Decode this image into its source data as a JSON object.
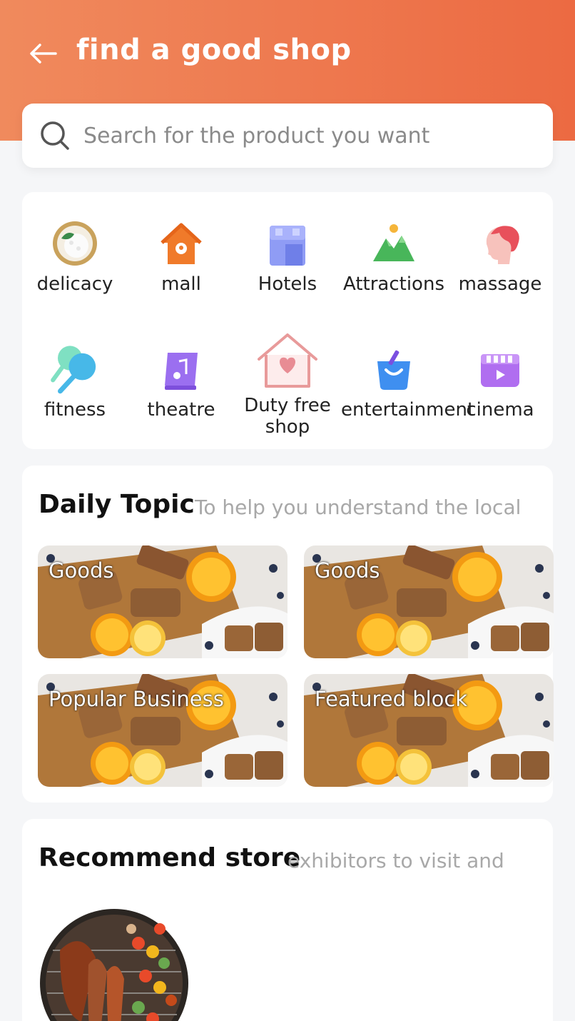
{
  "header": {
    "title": "find a good shop",
    "back_icon": "back-arrow-icon"
  },
  "search": {
    "placeholder": "Search for the product you want",
    "icon": "search-icon"
  },
  "categories": [
    {
      "label": "delicacy",
      "icon": "rice-bowl-icon"
    },
    {
      "label": "mall",
      "icon": "mall-house-icon"
    },
    {
      "label": "Hotels",
      "icon": "hotel-icon"
    },
    {
      "label": "Attractions",
      "icon": "mountain-icon"
    },
    {
      "label": "massage",
      "icon": "massage-icon"
    },
    {
      "label": "fitness",
      "icon": "fitness-icon"
    },
    {
      "label": "theatre",
      "icon": "theatre-icon"
    },
    {
      "label": "Duty free shop",
      "icon": "duty-free-house-icon"
    },
    {
      "label": "entertainment",
      "icon": "shopping-basket-icon"
    },
    {
      "label": "cinema",
      "icon": "cinema-icon"
    }
  ],
  "daily_topic": {
    "title": "Daily Topic",
    "subtitle": "To help you understand the local",
    "tiles": [
      {
        "label": "Goods"
      },
      {
        "label": "Goods"
      },
      {
        "label": "Popular Business"
      },
      {
        "label": "Featured block"
      }
    ]
  },
  "recommend": {
    "title": "Recommend store",
    "subtitle": "exhibitors to visit and"
  },
  "colors": {
    "header_start": "#f08a5d",
    "header_end": "#ec6a42",
    "background": "#f5f6f8"
  }
}
